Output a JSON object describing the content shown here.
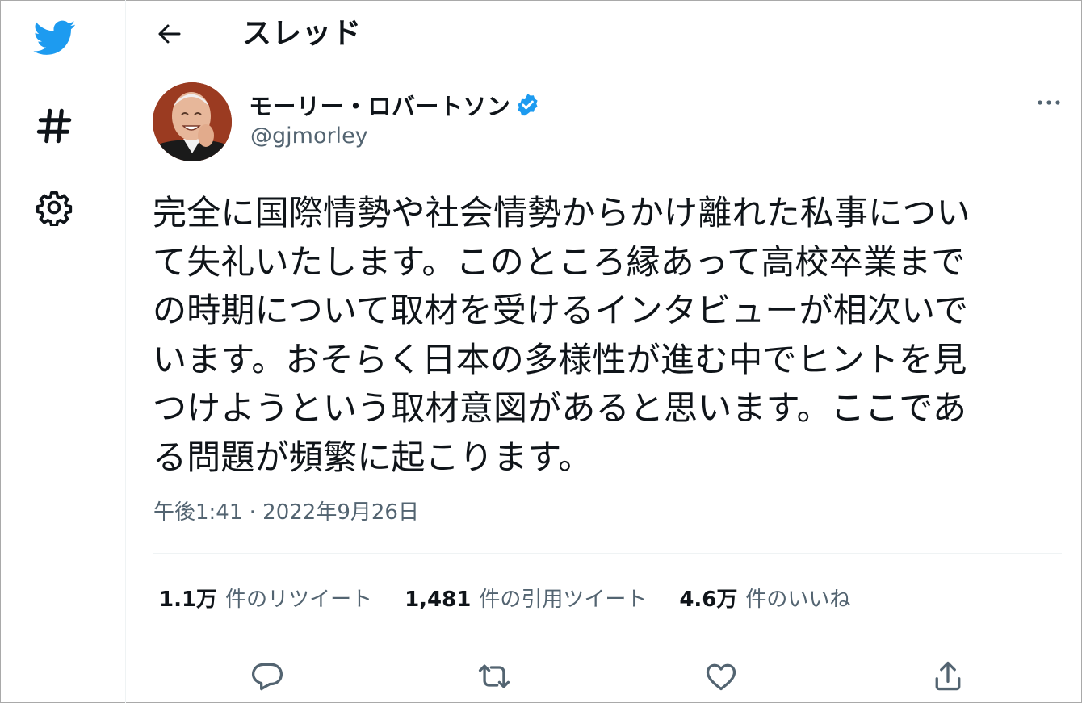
{
  "header": {
    "title": "スレッド"
  },
  "tweet": {
    "author_name": "モーリー・ロバートソン",
    "author_handle": "@gjmorley",
    "text": "完全に国際情勢や社会情勢からかけ離れた私事につい\nて失礼いたします。このところ縁あって高校卒業まで\nの時期について取材を受けるインタビューが相次いで\nいます。おそらく日本の多様性が進む中でヒントを見\nつけようという取材意図があると思います。ここであ\nる問題が頻繁に起こります。",
    "timestamp": "午後1:41 · 2022年9月26日"
  },
  "stats": {
    "retweets_count": "1.1万",
    "retweets_label": "件のリツイート",
    "quotes_count": "1,481",
    "quotes_label": "件の引用ツイート",
    "likes_count": "4.6万",
    "likes_label": "件のいいね"
  },
  "icons": {
    "logo": "twitter-bird-icon",
    "explore": "hashtag-icon",
    "settings": "gear-icon",
    "back": "back-arrow-icon",
    "verified": "verified-badge-icon",
    "more": "more-icon",
    "reply": "reply-icon",
    "retweet": "retweet-icon",
    "like": "heart-icon",
    "share": "share-icon"
  },
  "colors": {
    "brand": "#1d9bf0",
    "text": "#0f1419",
    "secondary": "#536471"
  }
}
